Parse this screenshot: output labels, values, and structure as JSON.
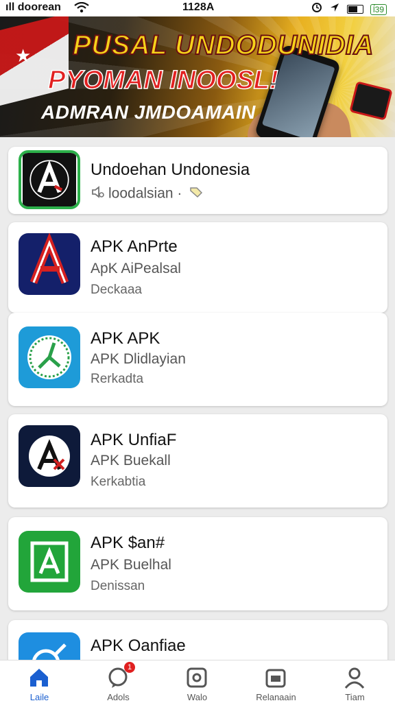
{
  "status_bar": {
    "carrier": "ıll doorean",
    "time": "1128A",
    "battery_text": "ĺ39",
    "icons": [
      "wifi-icon",
      "alarm-icon",
      "location-icon",
      "battery-icon"
    ]
  },
  "banner": {
    "line1": "PUSAL UNDODUNIDIA",
    "line2": "PYOMAN INOOSL!",
    "line3": "ADMRAN JMDOAMAIN"
  },
  "apps": [
    {
      "title": "Undoehan Undonesia",
      "subtitle": "loodalsian ·",
      "meta": ""
    },
    {
      "title": "APK AnPrte",
      "subtitle": "ApK AiPealsal",
      "meta": "Deckaaa"
    },
    {
      "title": "APK APK",
      "subtitle": "APK Dlidlayian",
      "meta": "Rerkadta"
    },
    {
      "title": "APK UnfiaF",
      "subtitle": "APK Buekall",
      "meta": "Kerkabtia"
    },
    {
      "title": "APK $an#",
      "subtitle": "APK Buelhal",
      "meta": "Denissan"
    },
    {
      "title": "APK Oanfiae",
      "subtitle": "",
      "meta": ""
    }
  ],
  "tabs": [
    {
      "label": "Laile",
      "icon": "home-icon",
      "active": true
    },
    {
      "label": "Adols",
      "icon": "chat-icon",
      "badge": "1"
    },
    {
      "label": "Walo",
      "icon": "apps-icon"
    },
    {
      "label": "Relanaain",
      "icon": "inbox-icon"
    },
    {
      "label": "Tiam",
      "icon": "profile-icon"
    }
  ],
  "colors": {
    "accent": "#1a5fd0",
    "banner_yellow": "#f5d21a",
    "banner_red": "#e22020"
  }
}
